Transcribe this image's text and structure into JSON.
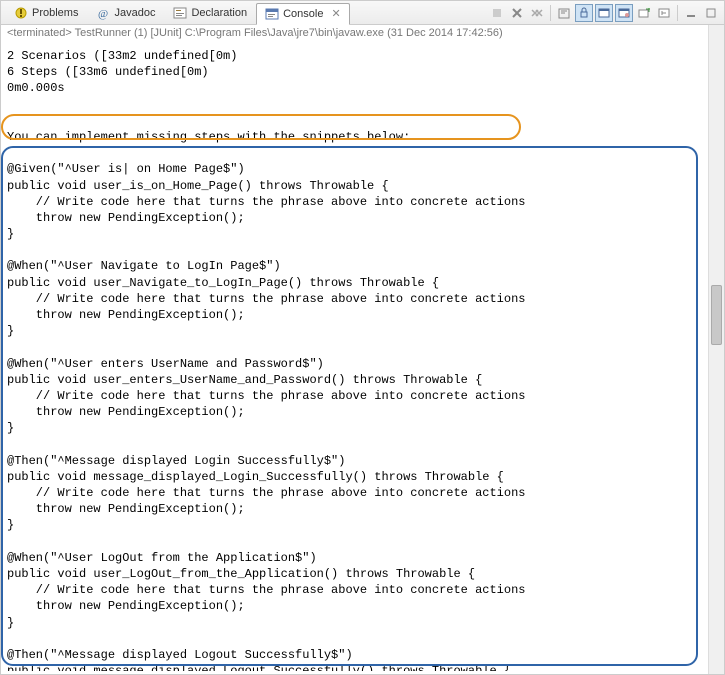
{
  "tabs": [
    {
      "label": "Problems",
      "icon": "problems"
    },
    {
      "label": "Javadoc",
      "icon": "javadoc"
    },
    {
      "label": "Declaration",
      "icon": "declaration"
    },
    {
      "label": "Console",
      "icon": "console",
      "active": true
    }
  ],
  "status": "<terminated> TestRunner (1) [JUnit] C:\\Program Files\\Java\\jre7\\bin\\javaw.exe (31 Dec 2014 17:42:56)",
  "console": {
    "summary": [
      "2 Scenarios (\u001b[33m2 undefined\u001b[0m)",
      "6 Steps (\u001b[33m6 undefined\u001b[0m)",
      "0m0.000s"
    ],
    "hint": "You can implement missing steps with the snippets below:",
    "snippets": [
      "@Given(\"^User is| on Home Page$\")\npublic void user_is_on_Home_Page() throws Throwable {\n    // Write code here that turns the phrase above into concrete actions\n    throw new PendingException();\n}",
      "@When(\"^User Navigate to LogIn Page$\")\npublic void user_Navigate_to_LogIn_Page() throws Throwable {\n    // Write code here that turns the phrase above into concrete actions\n    throw new PendingException();\n}",
      "@When(\"^User enters UserName and Password$\")\npublic void user_enters_UserName_and_Password() throws Throwable {\n    // Write code here that turns the phrase above into concrete actions\n    throw new PendingException();\n}",
      "@Then(\"^Message displayed Login Successfully$\")\npublic void message_displayed_Login_Successfully() throws Throwable {\n    // Write code here that turns the phrase above into concrete actions\n    throw new PendingException();\n}",
      "@When(\"^User LogOut from the Application$\")\npublic void user_LogOut_from_the_Application() throws Throwable {\n    // Write code here that turns the phrase above into concrete actions\n    throw new PendingException();\n}",
      "@Then(\"^Message displayed Logout Successfully$\")\npublic void message_displayed_Logout_Successfully() throws Throwable {"
    ]
  }
}
